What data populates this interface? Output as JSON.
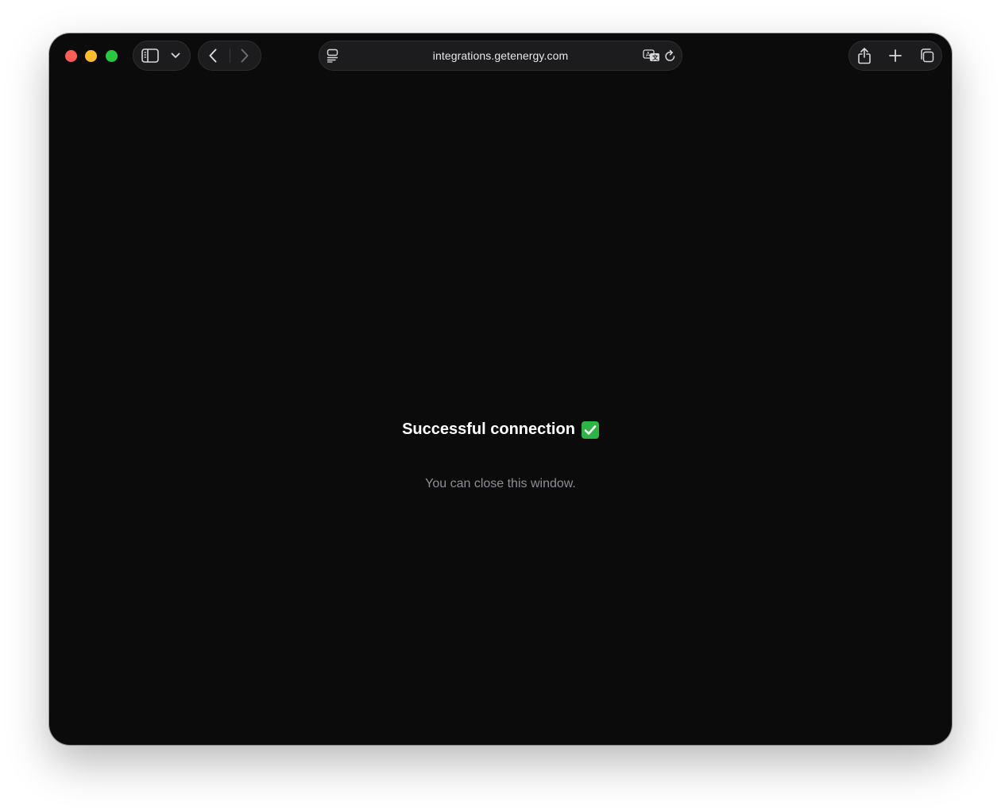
{
  "browser": {
    "url": "integrations.getenergy.com",
    "icons": {
      "close": "window-close-icon",
      "minimize": "window-minimize-icon",
      "maximize": "window-maximize-icon",
      "sidebar": "sidebar-icon",
      "chevron": "chevron-down-icon",
      "back": "chevron-left-icon",
      "forward": "chevron-right-icon",
      "page_menu": "page-menu-icon",
      "translate": "translate-icon",
      "reload": "reload-icon",
      "share": "share-icon",
      "new_tab": "plus-icon",
      "tabs": "tab-overview-icon"
    },
    "colors": {
      "close": "#ff5f57",
      "minimize": "#febc2e",
      "maximize": "#28c840",
      "background": "#0b0b0c"
    }
  },
  "page": {
    "heading": "Successful connection",
    "heading_emoji": "✅",
    "subtext": "You can close this window."
  }
}
